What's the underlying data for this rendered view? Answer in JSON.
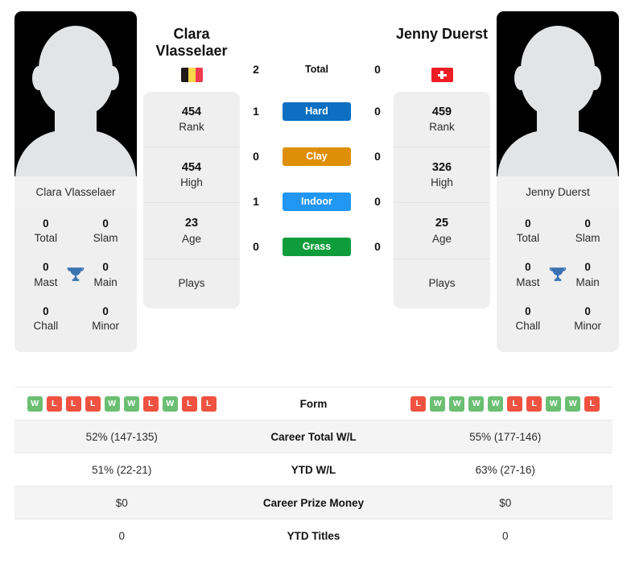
{
  "players": {
    "left": {
      "name": "Clara Vlasselaer",
      "name_line1": "Clara",
      "name_line2": "Vlasselaer",
      "country": "Belgium",
      "flag_icon": "flag-belgium-icon",
      "photo_caption": "Clara Vlasselaer",
      "titles": {
        "total_value": "0",
        "total_label": "Total",
        "slam_value": "0",
        "slam_label": "Slam",
        "mast_value": "0",
        "mast_label": "Mast",
        "main_value": "0",
        "main_label": "Main",
        "chall_value": "0",
        "chall_label": "Chall",
        "minor_value": "0",
        "minor_label": "Minor"
      },
      "stats": {
        "rank_value": "454",
        "rank_label": "Rank",
        "high_value": "454",
        "high_label": "High",
        "age_value": "23",
        "age_label": "Age",
        "plays_label": "Plays",
        "plays_value": ""
      },
      "h2h": {
        "total": "2",
        "hard": "1",
        "clay": "0",
        "indoor": "1",
        "grass": "0"
      },
      "form": [
        "W",
        "L",
        "L",
        "L",
        "W",
        "W",
        "L",
        "W",
        "L",
        "L"
      ],
      "career_total_wl": "52% (147-135)",
      "ytd_wl": "51% (22-21)",
      "career_prize_money": "$0",
      "ytd_titles": "0"
    },
    "right": {
      "name": "Jenny Duerst",
      "name_line1": "Jenny Duerst",
      "name_line2": "",
      "country": "Switzerland",
      "flag_icon": "flag-switzerland-icon",
      "photo_caption": "Jenny Duerst",
      "titles": {
        "total_value": "0",
        "total_label": "Total",
        "slam_value": "0",
        "slam_label": "Slam",
        "mast_value": "0",
        "mast_label": "Mast",
        "main_value": "0",
        "main_label": "Main",
        "chall_value": "0",
        "chall_label": "Chall",
        "minor_value": "0",
        "minor_label": "Minor"
      },
      "stats": {
        "rank_value": "459",
        "rank_label": "Rank",
        "high_value": "326",
        "high_label": "High",
        "age_value": "25",
        "age_label": "Age",
        "plays_label": "Plays",
        "plays_value": ""
      },
      "h2h": {
        "total": "0",
        "hard": "0",
        "clay": "0",
        "indoor": "0",
        "grass": "0"
      },
      "form": [
        "L",
        "W",
        "W",
        "W",
        "W",
        "L",
        "L",
        "W",
        "W",
        "L"
      ],
      "career_total_wl": "55% (177-146)",
      "ytd_wl": "63% (27-16)",
      "career_prize_money": "$0",
      "ytd_titles": "0"
    }
  },
  "surfaces": [
    {
      "key": "total",
      "label": "Total",
      "color": "transparent",
      "plain": true
    },
    {
      "key": "hard",
      "label": "Hard",
      "color": "#0c6fc2",
      "plain": false
    },
    {
      "key": "clay",
      "label": "Clay",
      "color": "#df8f06",
      "plain": false
    },
    {
      "key": "indoor",
      "label": "Indoor",
      "color": "#2196f3",
      "plain": false
    },
    {
      "key": "grass",
      "label": "Grass",
      "color": "#0f9d3c",
      "plain": false
    }
  ],
  "table_rows": {
    "form_label": "Form",
    "career_total_wl_label": "Career Total W/L",
    "ytd_wl_label": "YTD W/L",
    "career_prize_money_label": "Career Prize Money",
    "ytd_titles_label": "YTD Titles"
  },
  "colors": {
    "hard": "#0c6fc2",
    "clay": "#df8f06",
    "indoor": "#2196f3",
    "grass": "#0f9d3c",
    "win": "#6bbf73",
    "loss": "#ef5241",
    "trophy": "#3a72b0",
    "card_bg": "#efefef"
  }
}
